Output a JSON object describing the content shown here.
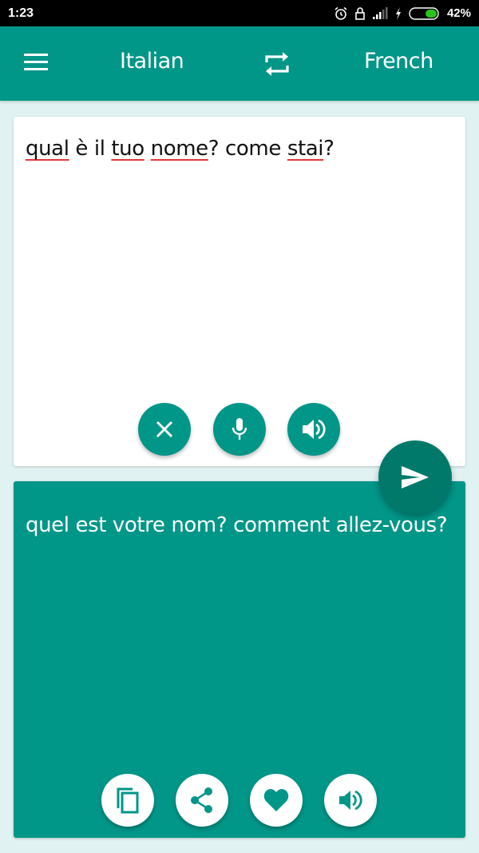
{
  "status_bar": {
    "time": "1:23",
    "icons": [
      "alarm-icon",
      "lock-icon",
      "signal-icon",
      "charging-icon",
      "battery-icon"
    ],
    "battery_percent": "42%",
    "battery_level": 0.42
  },
  "app_bar": {
    "menu_icon": "hamburger-menu-icon",
    "source_language": "Italian",
    "swap_icon": "swap-languages-icon",
    "target_language": "French"
  },
  "source": {
    "words": [
      {
        "text": "qual",
        "misspelled": true
      },
      {
        "text": " è il ",
        "misspelled": false
      },
      {
        "text": "tuo",
        "misspelled": true
      },
      {
        "text": " ",
        "misspelled": false
      },
      {
        "text": "nome",
        "misspelled": true
      },
      {
        "text": "? come ",
        "misspelled": false
      },
      {
        "text": "stai",
        "misspelled": true
      },
      {
        "text": "?",
        "misspelled": false
      }
    ],
    "actions": [
      "clear-icon",
      "microphone-icon",
      "speaker-icon"
    ]
  },
  "translate_button": {
    "icon": "send-icon"
  },
  "target": {
    "text": "quel est votre nom? comment allez-vous?",
    "actions": [
      "copy-icon",
      "share-icon",
      "favorite-icon",
      "speaker-icon"
    ]
  },
  "colors": {
    "primary": "#009688",
    "primary_dark": "#00796b",
    "background": "#e0f2f1",
    "spell_error": "#e53935"
  }
}
